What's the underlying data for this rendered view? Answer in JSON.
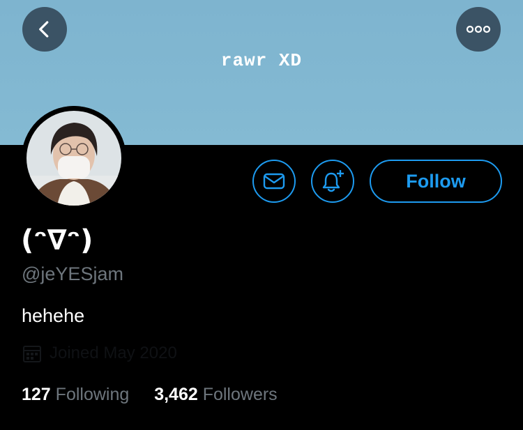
{
  "banner": {
    "text": "rawr XD"
  },
  "profile": {
    "display_name": "(ᵔ∇ᵔ)",
    "handle": "@jeYESjam",
    "bio": "hehehe",
    "joined": "Joined May 2020"
  },
  "actions": {
    "follow_label": "Follow"
  },
  "stats": {
    "following_count": "127",
    "following_label": "Following",
    "followers_count": "3,462",
    "followers_label": "Followers"
  },
  "colors": {
    "accent": "#1d9bf0",
    "banner": "#84bad3",
    "secondary_text": "#6e767d",
    "background": "#000000"
  },
  "icons": {
    "back": "chevron-left-icon",
    "more": "more-horizontal-icon",
    "message": "envelope-icon",
    "notify": "bell-plus-icon",
    "calendar": "calendar-icon"
  }
}
